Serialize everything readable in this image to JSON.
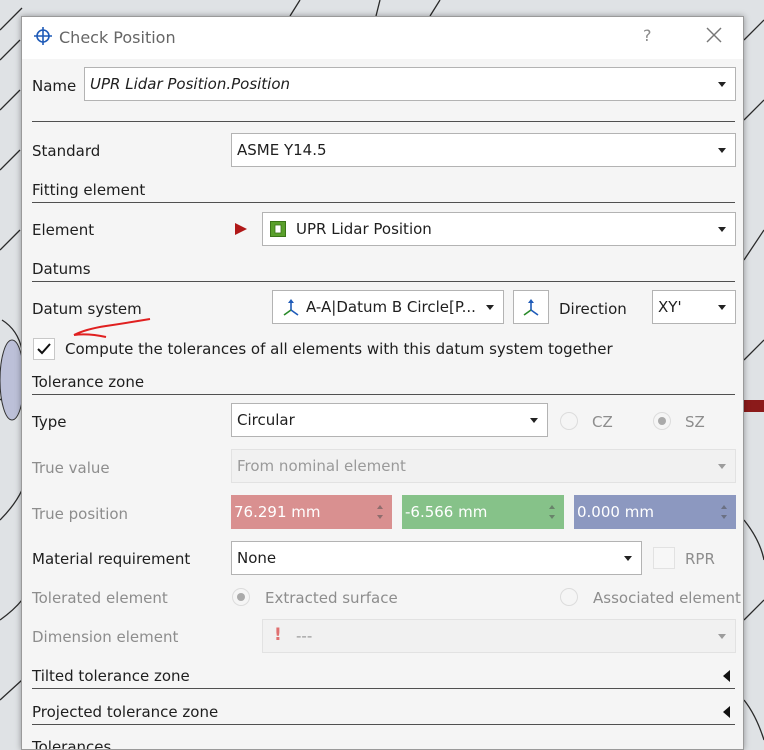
{
  "window": {
    "title": "Check Position",
    "help": "?"
  },
  "name": {
    "label": "Name",
    "value": "UPR Lidar Position.Position"
  },
  "standard": {
    "label": "Standard",
    "value": "ASME Y14.5"
  },
  "fitting": {
    "heading": "Fitting element",
    "element_label": "Element",
    "element_value": "UPR Lidar Position"
  },
  "datums": {
    "heading": "Datums",
    "system_label": "Datum system",
    "system_value": "A-A|Datum B Circle[P...",
    "direction_label": "Direction",
    "direction_value": "XY'",
    "compute_together_label": "Compute the tolerances of all elements with this datum system together",
    "compute_together_checked": true
  },
  "tolerance_zone": {
    "heading": "Tolerance zone",
    "type_label": "Type",
    "type_value": "Circular",
    "cz_label": "CZ",
    "sz_label": "SZ",
    "selected_zone": "SZ",
    "true_value_label": "True value",
    "true_value_value": "From nominal element",
    "true_position_label": "True position",
    "true_position": {
      "x": "76.291 mm",
      "y": "-6.566 mm",
      "z": "0.000 mm"
    },
    "material_label": "Material requirement",
    "material_value": "None",
    "rpr_label": "RPR",
    "tolerated_label": "Tolerated element",
    "extracted_label": "Extracted surface",
    "associated_label": "Associated element",
    "selected_tolerated": "Extracted surface",
    "dimension_label": "Dimension element",
    "dimension_value": "---"
  },
  "sections": {
    "tilted": "Tilted tolerance zone",
    "projected": "Projected tolerance zone",
    "tolerances": "Tolerances"
  },
  "colors": {
    "x_field": "#d99090",
    "y_field": "#86c289",
    "z_field": "#8c98c0",
    "annotation": "#e02020",
    "element_marker": "#b01818",
    "element_icon": "#5aa02c"
  },
  "icons": {
    "title": "crosshair-icon",
    "element_marker": "triangle-right-icon",
    "element_type": "surface-point-icon",
    "datum": "axis-system-icon",
    "warning": "exclamation-icon"
  }
}
